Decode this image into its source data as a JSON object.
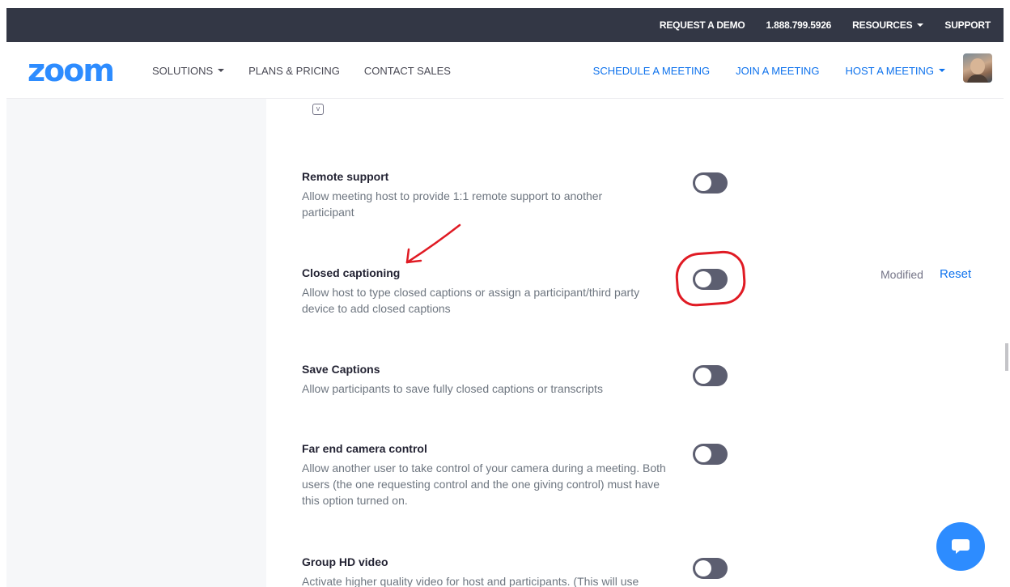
{
  "topbar": {
    "request_demo": "REQUEST A DEMO",
    "phone": "1.888.799.5926",
    "resources": "RESOURCES",
    "support": "SUPPORT"
  },
  "nav": {
    "logo": "zoom",
    "solutions": "SOLUTIONS",
    "plans_pricing": "PLANS & PRICING",
    "contact_sales": "CONTACT SALES",
    "schedule": "SCHEDULE A MEETING",
    "join": "JOIN A MEETING",
    "host": "HOST A MEETING"
  },
  "settings": [
    {
      "title": "Remote support",
      "desc": "Allow meeting host to provide 1:1 remote support to another participant",
      "enabled": false
    },
    {
      "title": "Closed captioning",
      "desc": "Allow host to type closed captions or assign a participant/third party device to add closed captions",
      "enabled": false,
      "modified": "Modified",
      "reset": "Reset"
    },
    {
      "title": "Save Captions",
      "desc": "Allow participants to save fully closed captions or transcripts",
      "enabled": false
    },
    {
      "title": "Far end camera control",
      "desc": "Allow another user to take control of your camera during a meeting. Both users (the one requesting control and the one giving control) must have this option turned on.",
      "enabled": false
    },
    {
      "title": "Group HD video",
      "desc": "Activate higher quality video for host and participants. (This will use",
      "enabled": false
    }
  ],
  "colors": {
    "brand": "#2d8cff",
    "link": "#0e72ed",
    "topbar": "#333745",
    "toggle_off": "#5c5e70",
    "annotation": "#e01b24"
  },
  "icons": {
    "chat": "chat-bubble-icon",
    "avatar": "user-avatar",
    "caret": "caret-down-icon"
  }
}
